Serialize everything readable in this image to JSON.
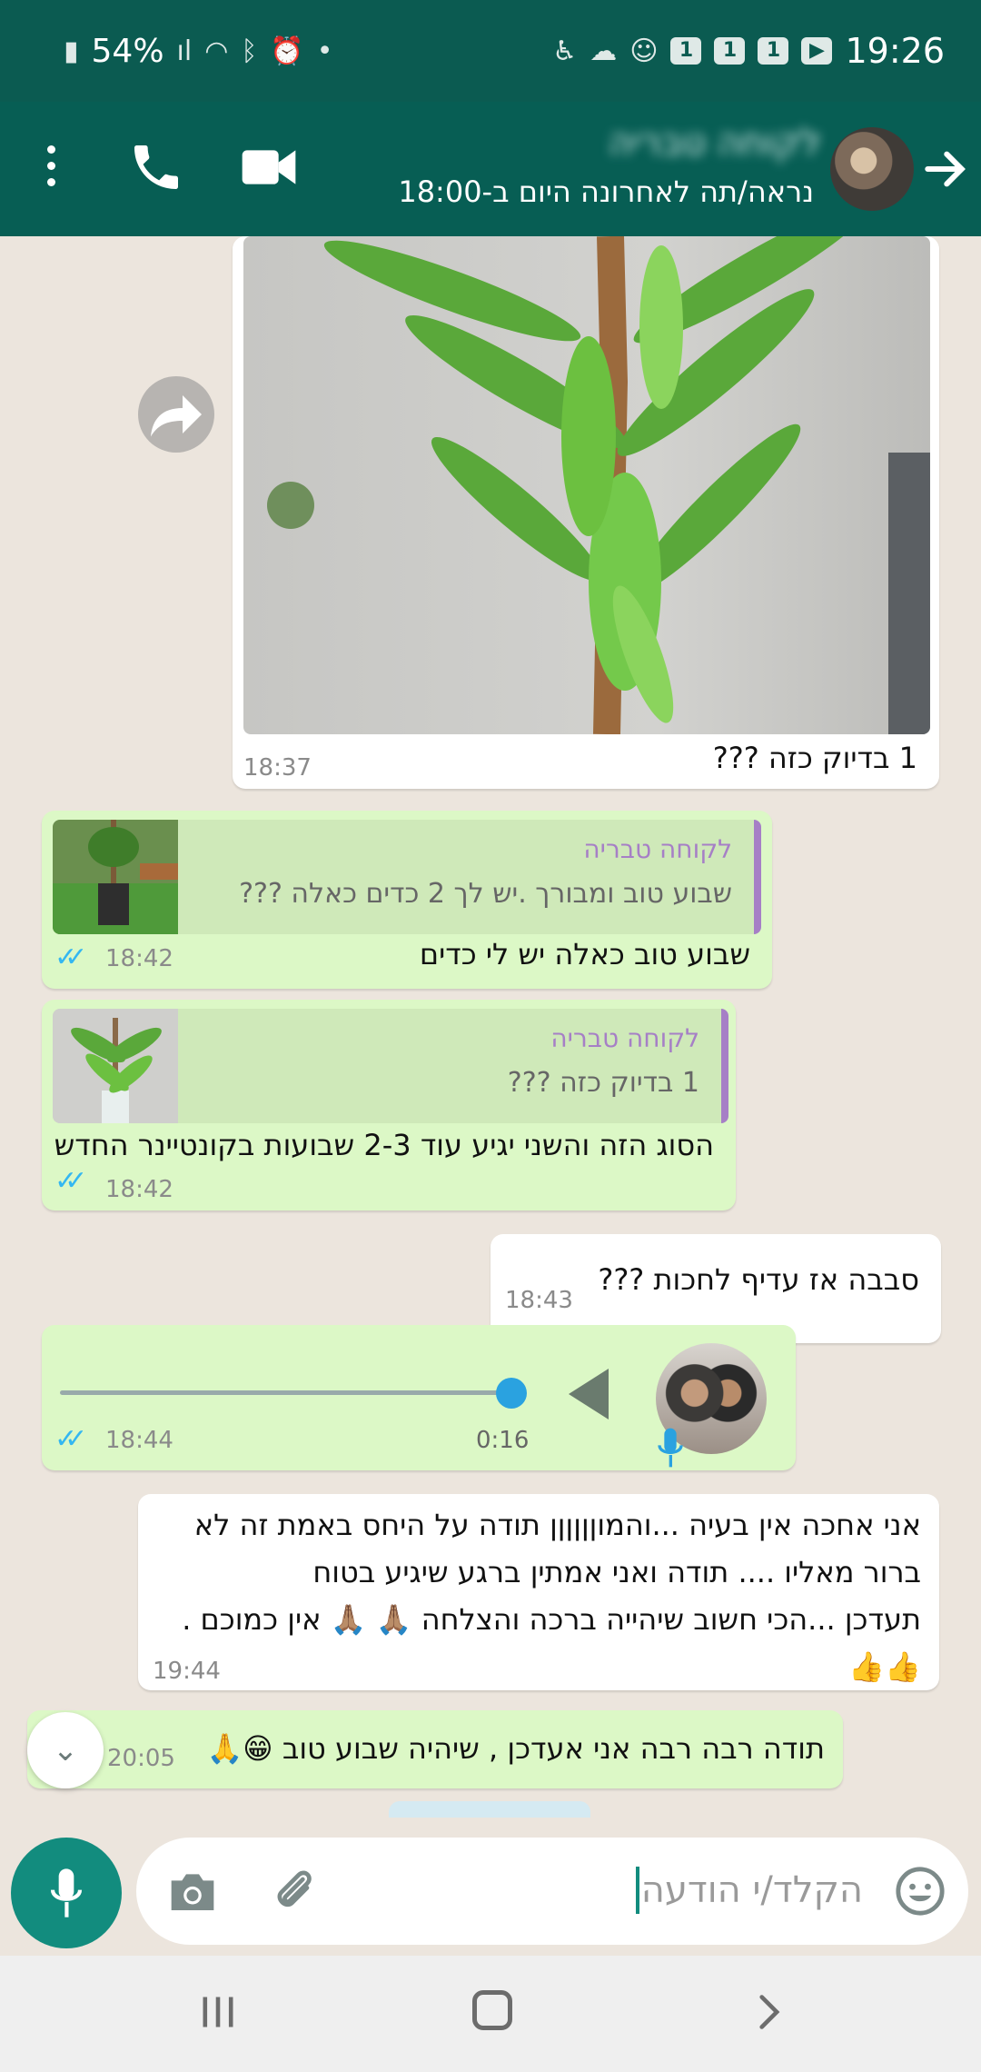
{
  "status_bar": {
    "battery": "54%",
    "time": "19:26",
    "notif_badges": [
      "1",
      "1",
      "1"
    ]
  },
  "header": {
    "contact_name": "לקוחה טבריה",
    "last_seen": "נראה/תה לאחרונה היום ב-18:00"
  },
  "messages": {
    "image_msg": {
      "caption": "1 בדיוק כזה ???",
      "time": "18:37"
    },
    "reply1": {
      "quote_name": "לקוחה טבריה",
      "quote_text": "שבוע טוב ומבורך .יש לך 2 כדים כאלה ???",
      "text": "שבוע טוב כאלה יש לי כדים",
      "time": "18:42"
    },
    "reply2": {
      "quote_name": "לקוחה טבריה",
      "quote_text": "1 בדיוק כזה ???",
      "text": "הסוג הזה והשני יגיע עוד 2-3 שבועות בקונטיינר החדש",
      "time": "18:42"
    },
    "incoming1": {
      "text": "סבבה אז עדיף לחכות ???",
      "time": "18:43"
    },
    "voice": {
      "duration": "0:16",
      "time": "18:44",
      "progress": 1.0
    },
    "incoming2": {
      "text": "אני אחכה אין בעיה ...והמוןןןןןן תודה על היחס באמת זה לא\nברור מאליו .... תודה ואני אמתין ברגע שיגיע בטוח\nתעדכן ...הכי חשוב שיהייה ברכה והצלחה 🙏🏽 🙏🏽 אין כמוכם .\n👍👍",
      "time": "19:44"
    },
    "outgoing_last": {
      "text": "תודה רבה רבה אני אעדכן , שיהיה שבוע טוב 😁🙏",
      "time": "20:05"
    }
  },
  "input": {
    "placeholder": "הקלד/י הודעה"
  },
  "colors": {
    "header": "#075e54",
    "status_bar": "#0b5b51",
    "outgoing_bubble": "#dcf8c6",
    "incoming_bubble": "#ffffff",
    "read_ticks": "#34b7f1",
    "accent": "#128c7e"
  }
}
